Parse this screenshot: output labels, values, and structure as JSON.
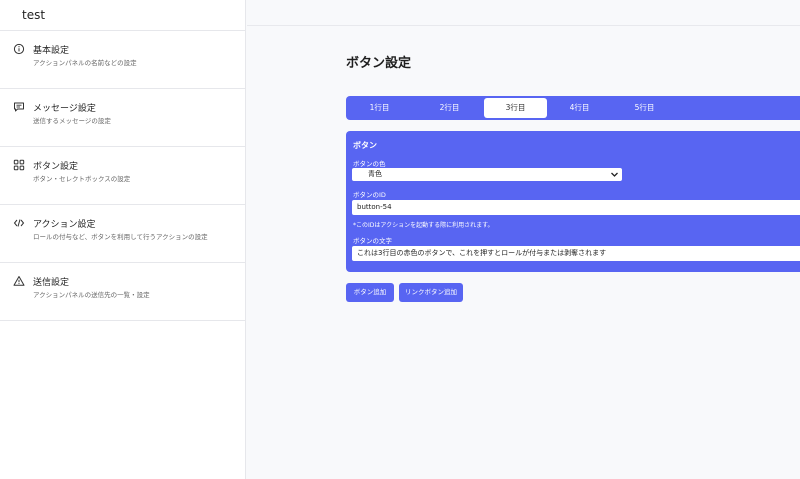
{
  "app": {
    "title": "test"
  },
  "sidebar": {
    "items": [
      {
        "label": "基本設定",
        "desc": "アクションパネルの名前などの設定",
        "icon": "info-icon"
      },
      {
        "label": "メッセージ設定",
        "desc": "送信するメッセージの設定",
        "icon": "message-icon"
      },
      {
        "label": "ボタン設定",
        "desc": "ボタン・セレクトボックスの設定",
        "icon": "grid-icon"
      },
      {
        "label": "アクション設定",
        "desc": "ロールの付与など、ボタンを利用して行うアクションの設定",
        "icon": "code-icon"
      },
      {
        "label": "送信設定",
        "desc": "アクションパネルの送信先の一覧・設定",
        "icon": "warning-icon"
      }
    ]
  },
  "main": {
    "title": "ボタン設定",
    "tabs": [
      {
        "label": "1行目"
      },
      {
        "label": "2行目"
      },
      {
        "label": "3行目",
        "active": true
      },
      {
        "label": "4行目"
      },
      {
        "label": "5行目"
      }
    ],
    "card": {
      "title": "ボタン",
      "color_label": "ボタンの色",
      "color_value": "青色",
      "id_label": "ボタンのID",
      "id_value": "button-54",
      "id_hint": "*このIDはアクションを起動する際に利用されます。",
      "text_label": "ボタンの文字",
      "text_value": "これは3行目の赤色のボタンで、これを押すとロールが付与または剥奪されます"
    },
    "buttons": {
      "add_button": "ボタン追加",
      "add_link_button": "リンクボタン追加"
    }
  },
  "colors": {
    "accent": "#5865f2",
    "sidebar_bg": "#ffffff",
    "main_bg": "#f8f9fb"
  }
}
